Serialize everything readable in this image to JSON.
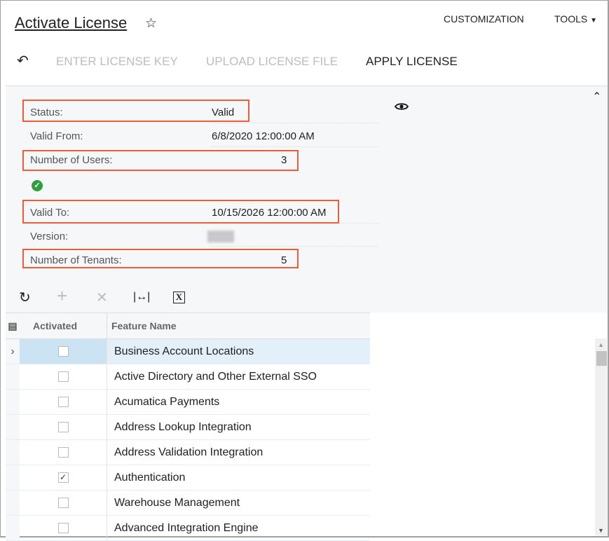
{
  "header": {
    "title": "Activate License",
    "nav": [
      "CUSTOMIZATION",
      "TOOLS"
    ]
  },
  "toolbar": {
    "enter_key": "ENTER LICENSE KEY",
    "upload_file": "UPLOAD LICENSE FILE",
    "apply": "APPLY LICENSE"
  },
  "form": {
    "status_label": "Status:",
    "status": "Valid",
    "valid_from_label": "Valid From:",
    "valid_from": "6/8/2020 12:00:00 AM",
    "users_label": "Number of Users:",
    "users": "3",
    "valid_to_label": "Valid To:",
    "valid_to": "10/15/2026 12:00:00 AM",
    "version_label": "Version:",
    "tenants_label": "Number of Tenants:",
    "tenants": "5"
  },
  "grid": {
    "columns": [
      "Activated",
      "Feature Name"
    ],
    "rows": [
      {
        "name": "Business Account Locations",
        "activated": false
      },
      {
        "name": "Active Directory and Other External SSO",
        "activated": false
      },
      {
        "name": "Acumatica Payments",
        "activated": false
      },
      {
        "name": "Address Lookup Integration",
        "activated": false
      },
      {
        "name": "Address Validation Integration",
        "activated": false
      },
      {
        "name": "Authentication",
        "activated": true
      },
      {
        "name": "Warehouse Management",
        "activated": false
      },
      {
        "name": "Advanced Integration Engine",
        "activated": false
      }
    ]
  },
  "colors": {
    "highlight": "#f05a35",
    "success": "#2e9e3e"
  }
}
